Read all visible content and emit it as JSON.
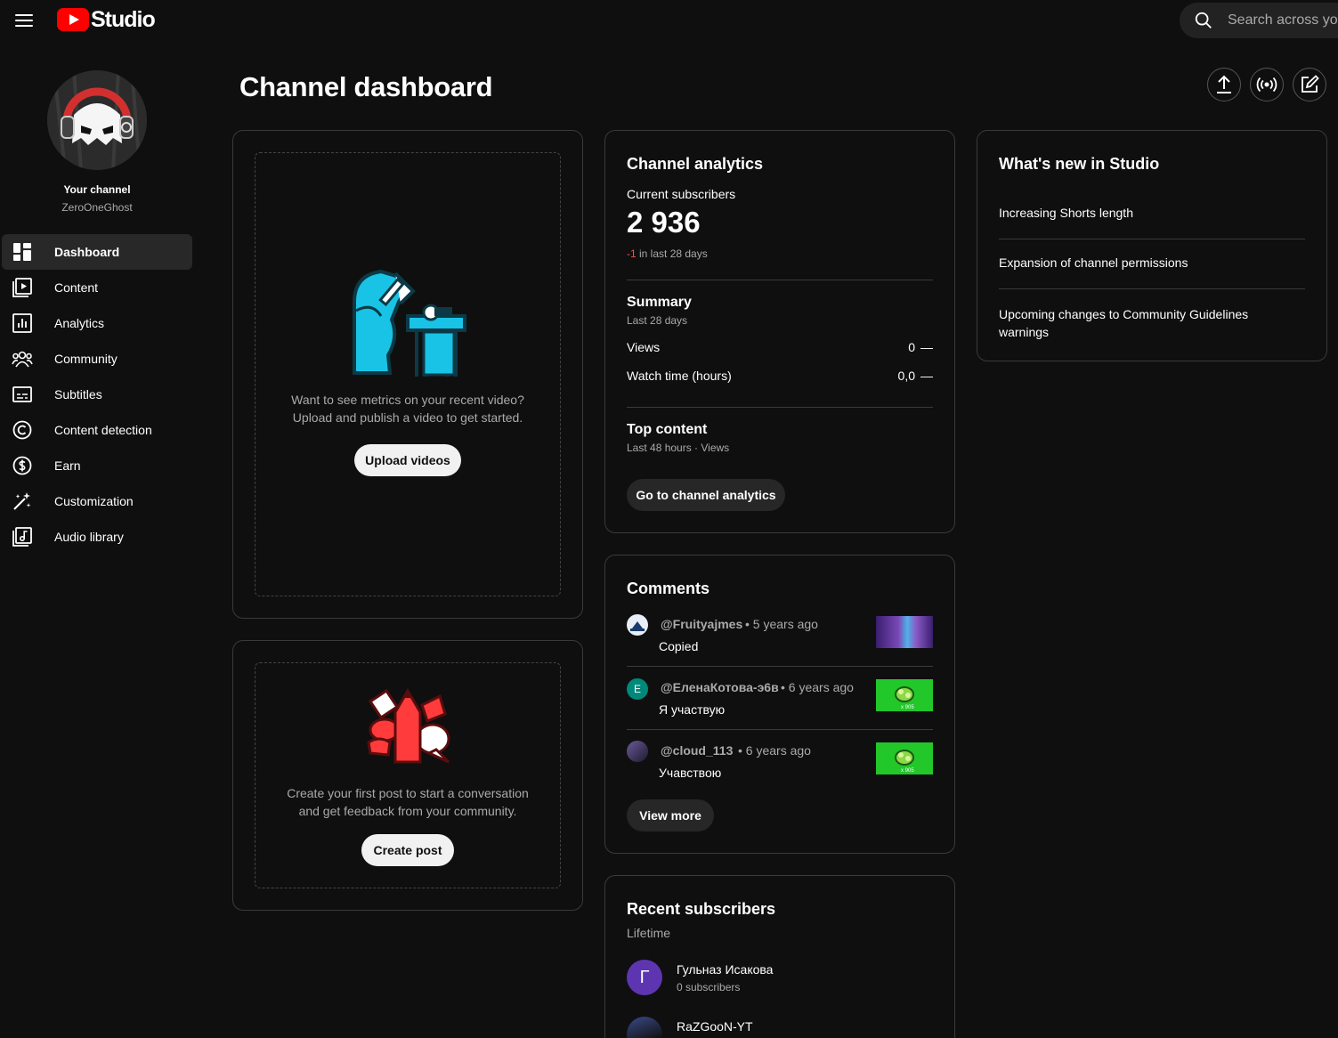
{
  "header": {
    "logo_text": "Studio",
    "search_placeholder": "Search across yo",
    "page_title": "Channel dashboard"
  },
  "channel": {
    "your_channel_label": "Your channel",
    "name": "ZeroOneGhost"
  },
  "sidebar": {
    "items": [
      {
        "label": "Dashboard",
        "icon": "dashboard-icon"
      },
      {
        "label": "Content",
        "icon": "content-icon"
      },
      {
        "label": "Analytics",
        "icon": "analytics-icon"
      },
      {
        "label": "Community",
        "icon": "community-icon"
      },
      {
        "label": "Subtitles",
        "icon": "subtitles-icon"
      },
      {
        "label": "Content detection",
        "icon": "copyright-icon"
      },
      {
        "label": "Earn",
        "icon": "dollar-icon"
      },
      {
        "label": "Customization",
        "icon": "magic-wand-icon"
      },
      {
        "label": "Audio library",
        "icon": "audio-library-icon"
      }
    ]
  },
  "upload_card": {
    "text_line1": "Want to see metrics on your recent video?",
    "text_line2": "Upload and publish a video to get started.",
    "button": "Upload videos"
  },
  "post_card": {
    "text_line1": "Create your first post to start a conversation",
    "text_line2": "and get feedback from your community.",
    "button": "Create post"
  },
  "analytics": {
    "title": "Channel analytics",
    "subscribers_label": "Current subscribers",
    "subscribers_value": "2 936",
    "change_value": "-1",
    "change_suffix": " in last 28 days",
    "summary_title": "Summary",
    "summary_period": "Last 28 days",
    "rows": [
      {
        "label": "Views",
        "value": "0",
        "trend": "—"
      },
      {
        "label": "Watch time (hours)",
        "value": "0,0",
        "trend": "—"
      }
    ],
    "top_content_title": "Top content",
    "top_content_sub": "Last 48 hours · Views",
    "button": "Go to channel analytics"
  },
  "comments": {
    "title": "Comments",
    "items": [
      {
        "author": "@Fruityajmes",
        "time": "• 5 years ago",
        "text": "Copied",
        "avatar_letter": ""
      },
      {
        "author": "@ЕленаКотова-э6в",
        "time": "• 6 years ago",
        "text": "Я участвую",
        "avatar_letter": "E"
      },
      {
        "author": "@cloud_113",
        "time": "• 6 years ago",
        "text": "Учавствою",
        "avatar_letter": ""
      }
    ],
    "button": "View more"
  },
  "recent_subscribers": {
    "title": "Recent subscribers",
    "period": "Lifetime",
    "items": [
      {
        "name": "Гульназ Исакова",
        "subs": "0 subscribers",
        "avatar_letter": "Г"
      },
      {
        "name": "RaZGooN-YT",
        "subs": "",
        "avatar_letter": ""
      }
    ]
  },
  "whats_new": {
    "title": "What's new in Studio",
    "items": [
      {
        "text": "Increasing Shorts length"
      },
      {
        "text": "Expansion of channel permissions"
      },
      {
        "text": "Upcoming changes to Community Guidelines warnings"
      }
    ]
  },
  "colors": {
    "background": "#0f0f0f",
    "card_border": "#3a3a3a",
    "brand_red": "#ff0000",
    "negative": "#ff4e45",
    "illustration_cyan": "#19c3e6",
    "illustration_red": "#ff3b3b",
    "subscriber_avatar": "#5e35b1",
    "comment_avatar_green": "#00897b"
  }
}
